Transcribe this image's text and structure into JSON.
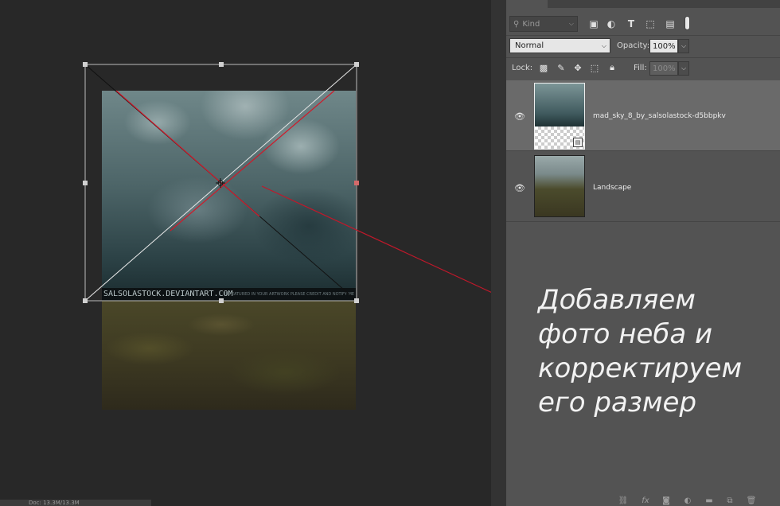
{
  "panel": {
    "filter_kind_label": "Kind",
    "blend_mode": "Normal",
    "opacity_label": "Opacity:",
    "opacity_value": "100%",
    "lock_label": "Lock:",
    "fill_label": "Fill:",
    "fill_value": "100%"
  },
  "layers": [
    {
      "name": "mad_sky_8_by_salsolastock-d5bbpkv",
      "selected": true,
      "visible": true
    },
    {
      "name": "Landscape",
      "selected": false,
      "visible": true
    }
  ],
  "canvas": {
    "watermark": "SALSOLASTOCK.DEVIANTART.COM",
    "watermark_small": "IF FEATURED IN YOUR ARTWORK PLEASE CREDIT AND NOTIFY ME"
  },
  "annotation": {
    "text": "Добавляем\nфото неба и\nкорректируем\nего размер"
  },
  "status": {
    "text": "Doc: 13.3M/13.3M"
  },
  "colors": {
    "panel_bg": "#535353",
    "canvas_bg": "#282828",
    "selected_layer": "#6a6a6a",
    "annotation_line": "#c0182a"
  }
}
